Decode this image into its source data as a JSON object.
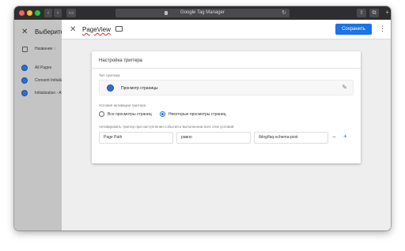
{
  "browser": {
    "url_title": "Google Tag Manager",
    "reload_glyph": "↻",
    "new_tab_glyph": "+",
    "colors": {
      "close": "#ff5f57",
      "minimize": "#febc2e",
      "zoom": "#28c840"
    }
  },
  "sidebar": {
    "close_glyph": "✕",
    "title": "Выберите",
    "column_header": "Название ↑",
    "items": [
      {
        "label": "All Pages"
      },
      {
        "label": "Consent Initialization - All Pages"
      },
      {
        "label": "Initialization - All Pages"
      }
    ]
  },
  "editor": {
    "close_glyph": "✕",
    "trigger_name": "PageView",
    "save_label": "Сохранить",
    "more_glyph": "⋮",
    "card": {
      "title": "Настройка триггера",
      "type_label": "Тип триггера",
      "type_value": "Просмотр страницы",
      "edit_glyph": "✎",
      "activation_label": "Условия активации триггера",
      "options": [
        {
          "label": "Все просмотры страниц",
          "selected": false
        },
        {
          "label": "Некоторые просмотры страниц",
          "selected": true
        }
      ],
      "condition_hint": "Активировать триггер при наступлении события и выполнении всех этих условий",
      "condition": {
        "variable": "Page Path",
        "operator": "равно",
        "value": "/blog/faq-schema-post"
      },
      "remove_glyph": "−",
      "add_glyph": "+"
    }
  },
  "colors": {
    "accent": "#1a73e8",
    "sidebar_bg": "#c4c4c4",
    "titlebar": "#2e2e30"
  }
}
